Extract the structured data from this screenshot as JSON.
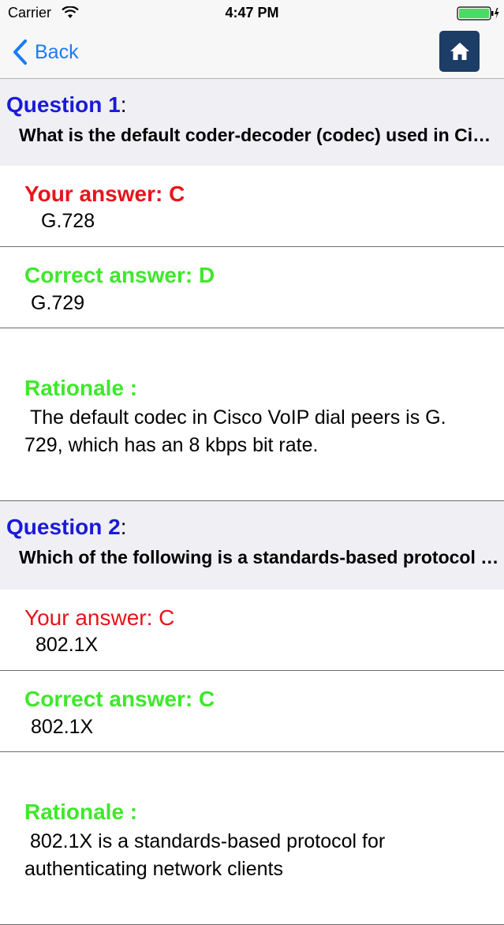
{
  "status_bar": {
    "carrier": "Carrier",
    "time": "4:47 PM",
    "battery_color": "#4cd964"
  },
  "nav": {
    "back_label": "Back",
    "back_icon": "chevron-left-icon",
    "home_icon": "home-icon",
    "home_button_color": "#1b3d66",
    "accent_color": "#1a7cf5"
  },
  "questions": [
    {
      "title": "Question 1",
      "text": "What is the default coder-decoder (codec) used in Cisco VoIP dial peers?",
      "your_answer_label": "Your answer: C",
      "your_answer_value": "G.728",
      "correct_answer_label": "Correct answer: D",
      "correct_answer_value": "G.729",
      "rationale_label": "Rationale :",
      "rationale_text": " The default codec in Cisco VoIP dial peers is G.\n729, which has an 8 kbps bit rate."
    },
    {
      "title": "Question 2",
      "text": "Which of the following is a standards-based protocol for authenticating network clients?",
      "your_answer_label": "Your answer: C",
      "your_answer_value": "802.1X",
      "correct_answer_label": "Correct answer: C",
      "correct_answer_value": "802.1X",
      "rationale_label": "Rationale :",
      "rationale_text": " 802.1X is a standards-based protocol for\nauthenticating network clients"
    }
  ],
  "colors": {
    "question_title": "#1a1ad8",
    "your_answer": "#e8131a",
    "correct_answer": "#3ee82b",
    "header_bg": "#efeff4"
  }
}
